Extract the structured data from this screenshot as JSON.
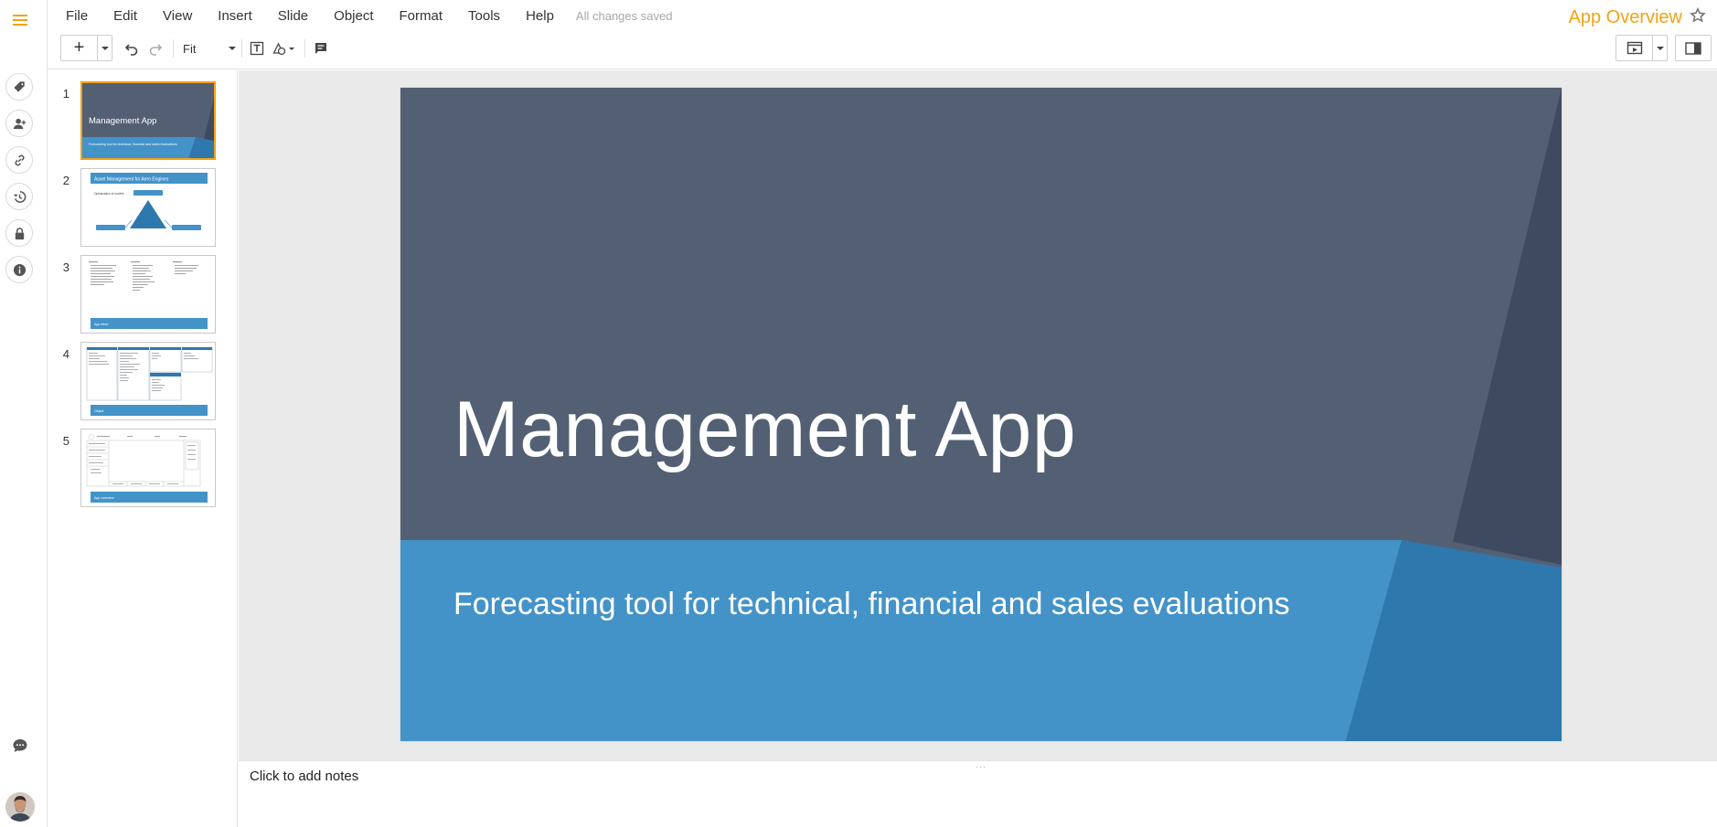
{
  "menubar": {
    "items": [
      "File",
      "Edit",
      "View",
      "Insert",
      "Slide",
      "Object",
      "Format",
      "Tools",
      "Help"
    ],
    "status": "All changes saved",
    "doc_title": "App Overview"
  },
  "toolbar": {
    "zoom": "Fit"
  },
  "filmstrip": {
    "slides": [
      {
        "number": "1",
        "active": true,
        "title": "Management App",
        "subtitle": "Forecasting tool for technical, financial and sales evaluations"
      },
      {
        "number": "2",
        "active": false,
        "title": "Asset Management for Aero Engines",
        "subtitle": "Optimization of models"
      },
      {
        "number": "3",
        "active": false,
        "title": "App effort"
      },
      {
        "number": "4",
        "active": false,
        "title": "Object"
      },
      {
        "number": "5",
        "active": false,
        "title": "App overview"
      }
    ]
  },
  "slide": {
    "title": "Management App",
    "subtitle": "Forecasting tool for technical, financial and sales evaluations"
  },
  "notes": {
    "placeholder": "Click to add notes"
  },
  "colors": {
    "accent": "#f2a212",
    "slide_dark": "#536074",
    "slide_blue": "#4393c9",
    "slide_blue_dark": "#2f78ad",
    "slide_shadow": "#3e4a60"
  }
}
